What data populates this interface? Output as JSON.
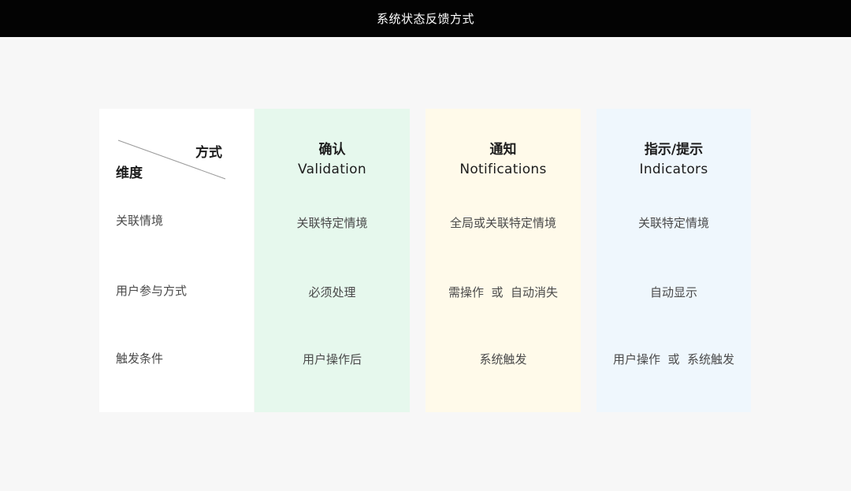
{
  "title": "系统状态反馈方式",
  "corner": {
    "top_label": "方式",
    "bottom_label": "维度"
  },
  "rows": [
    "关联情境",
    "用户参与方式",
    "触发条件"
  ],
  "columns": [
    {
      "title_zh": "确认",
      "title_en": "Validation",
      "cells": [
        "关联特定情境",
        "必须处理",
        "用户操作后"
      ],
      "color": "#e6f8ed"
    },
    {
      "title_zh": "通知",
      "title_en": "Notifications",
      "cells": [
        "全局或关联特定情境",
        "需操作  或  自动消失",
        "系统触发"
      ],
      "color": "#fffaea"
    },
    {
      "title_zh": "指示/提示",
      "title_en": "Indicators",
      "cells": [
        "关联特定情境",
        "自动显示",
        "用户操作  或  系统触发"
      ],
      "color": "#eff7fd"
    }
  ]
}
